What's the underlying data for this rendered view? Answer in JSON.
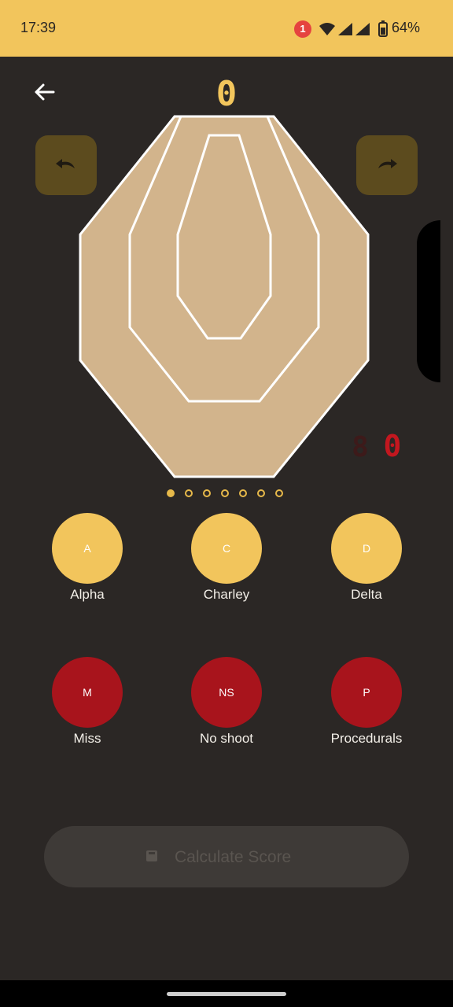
{
  "status_bar": {
    "time": "17:39",
    "notification_count": "1",
    "battery": "64%"
  },
  "header": {
    "score": "0"
  },
  "target": {
    "color": "#d2b48c",
    "outline_color": "#ffffff"
  },
  "penalty_display": {
    "value": "0"
  },
  "pager": {
    "count": 7,
    "active_index": 0
  },
  "hits": {
    "alpha": {
      "code": "A",
      "label": "Alpha"
    },
    "charley": {
      "code": "C",
      "label": "Charley"
    },
    "delta": {
      "code": "D",
      "label": "Delta"
    },
    "miss": {
      "code": "M",
      "label": "Miss"
    },
    "no_shoot": {
      "code": "NS",
      "label": "No shoot"
    },
    "procedurals": {
      "code": "P",
      "label": "Procedurals"
    }
  },
  "actions": {
    "calculate_label": "Calculate Score"
  },
  "colors": {
    "accent": "#f2c55c",
    "danger": "#a8141c",
    "background": "#2b2725"
  }
}
